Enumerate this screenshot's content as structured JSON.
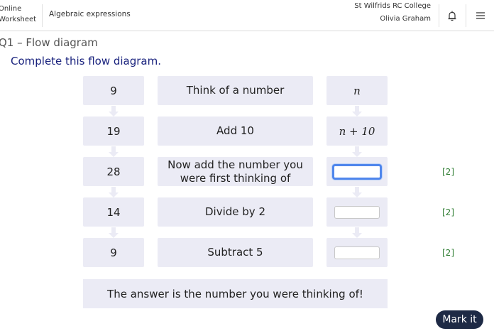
{
  "header": {
    "brand_line1": "Online",
    "brand_line2": "Worksheet",
    "breadcrumb": "Algebraic expressions",
    "school": "St Wilfrids RC College",
    "student": "Olivia Graham",
    "icons": [
      "bell-icon",
      "menu-icon"
    ]
  },
  "question": {
    "title": "Q1 – Flow diagram",
    "instruction": "Complete this flow diagram."
  },
  "rows": [
    {
      "value": "9",
      "step": "Think of a number",
      "expr": "n",
      "expr_type": "math",
      "marks": ""
    },
    {
      "value": "19",
      "step": "Add 10",
      "expr": "n + 10",
      "expr_type": "math",
      "marks": ""
    },
    {
      "value": "28",
      "step": "Now add the number you were first thinking of",
      "expr": "",
      "expr_type": "input",
      "input_value": "",
      "marks": "[2]"
    },
    {
      "value": "14",
      "step": "Divide by 2",
      "expr": "",
      "expr_type": "input",
      "input_value": "",
      "marks": "[2]"
    },
    {
      "value": "9",
      "step": "Subtract 5",
      "expr": "",
      "expr_type": "input",
      "input_value": "",
      "marks": "[2]"
    }
  ],
  "final_text": "The answer is the number you were thinking of!",
  "mark_button": "Mark it",
  "colors": {
    "accent": "#1e2a45",
    "box_bg": "#ebebf5",
    "marks": "#2e7d32",
    "instruction": "#1a237e",
    "focus": "#4f86ec"
  }
}
